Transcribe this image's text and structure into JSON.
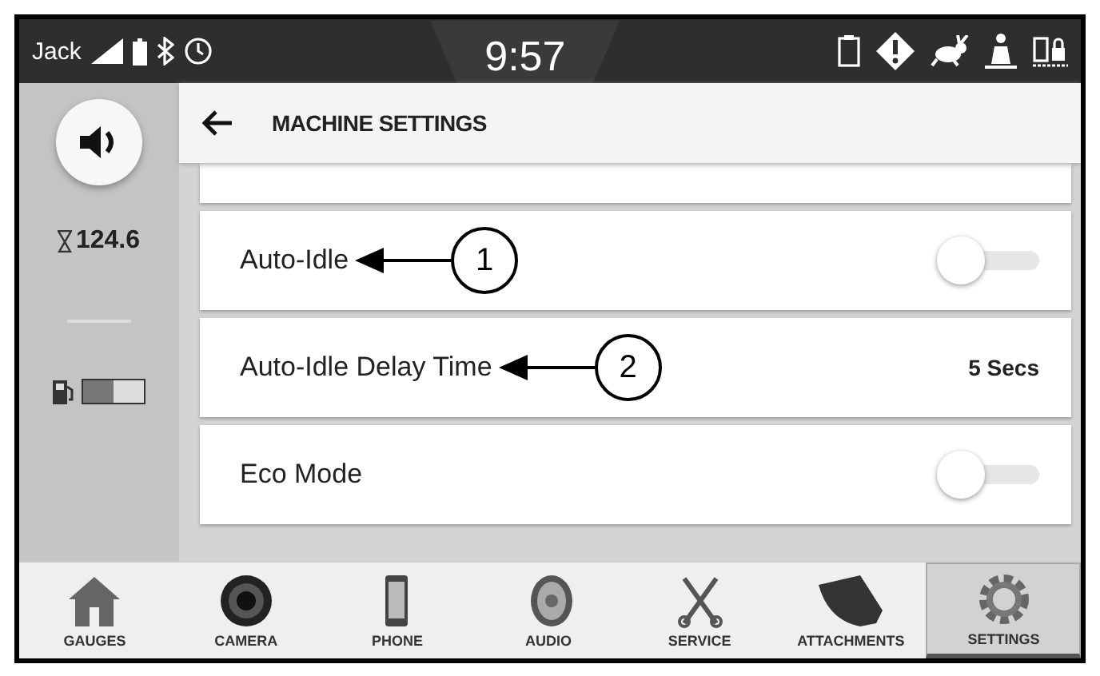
{
  "status_bar": {
    "user": "Jack",
    "time": "9:57"
  },
  "header": {
    "title": "MACHINE SETTINGS"
  },
  "side_panel": {
    "hours": "124.6",
    "fuel": {
      "level": 0.5
    }
  },
  "settings": [
    {
      "kind": "toggle",
      "label": "Auto-Idle",
      "on": false,
      "callout": "1"
    },
    {
      "kind": "value",
      "label": "Auto-Idle Delay Time",
      "value": "5 Secs",
      "callout": "2"
    },
    {
      "kind": "toggle",
      "label": "Eco Mode",
      "on": false
    }
  ],
  "nav": [
    {
      "label": "GAUGES",
      "selected": false
    },
    {
      "label": "CAMERA",
      "selected": false
    },
    {
      "label": "PHONE",
      "selected": false
    },
    {
      "label": "AUDIO",
      "selected": false
    },
    {
      "label": "SERVICE",
      "selected": false
    },
    {
      "label": "ATTACHMENTS",
      "selected": false
    },
    {
      "label": "SETTINGS",
      "selected": true
    }
  ]
}
